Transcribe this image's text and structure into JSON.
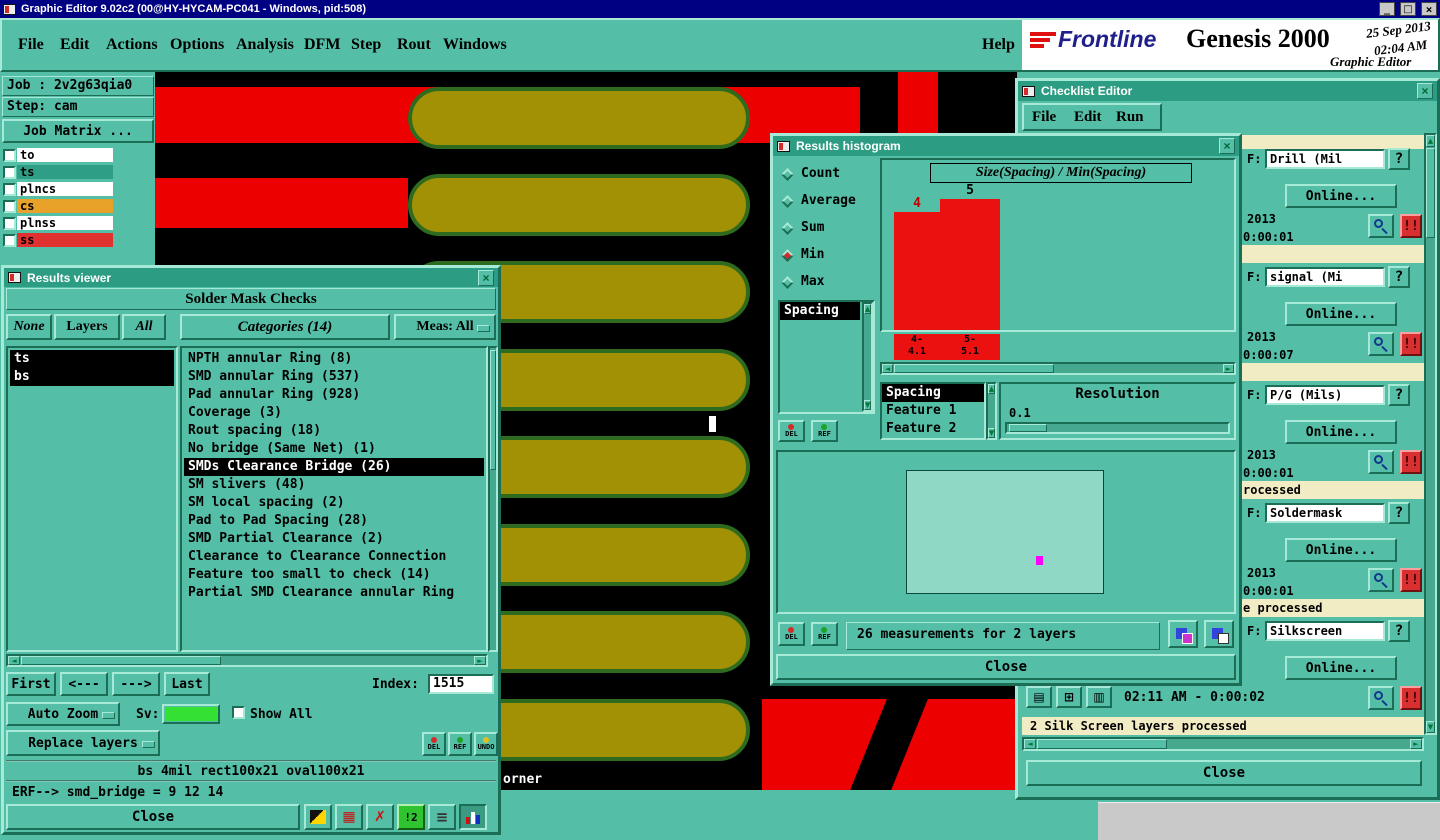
{
  "titlebar": {
    "title": "Graphic Editor 9.02c2 (00@HY-HYCAM-PC041 - Windows, pid:508)",
    "minimize": "_",
    "maximize": "□",
    "close": "×"
  },
  "icons": {
    "up": "▲",
    "down": "▼",
    "left": "◄",
    "right": "►",
    "close": "×"
  },
  "menubar": {
    "file": "File",
    "edit": "Edit",
    "actions": "Actions",
    "options": "Options",
    "analysis": "Analysis",
    "dfm": "DFM",
    "step": "Step",
    "rout": "Rout",
    "windows": "Windows",
    "help": "Help"
  },
  "brand": {
    "name": "Frontline",
    "product": "Genesis 2000",
    "date": "25 Sep 2013",
    "time": "02:04 AM",
    "app": "Graphic Editor"
  },
  "job": {
    "job": "Job : 2v2g63qia0",
    "step": "Step: cam",
    "matrix": "Job Matrix ...",
    "layers": [
      {
        "name": "to"
      },
      {
        "name": "ts"
      },
      {
        "name": "plncs"
      },
      {
        "name": "cs"
      },
      {
        "name": "plnss"
      },
      {
        "name": "ss"
      }
    ]
  },
  "canvas": {
    "corner_text": "orner"
  },
  "viewer": {
    "title": "Results viewer",
    "header": "Solder Mask Checks",
    "none": "None",
    "layers": "Layers",
    "all": "All",
    "categories_header": "Categories (14)",
    "meas": "Meas: All",
    "layer_items": [
      "ts",
      "bs"
    ],
    "categories": [
      "NPTH annular Ring (8)",
      "SMD annular Ring (537)",
      "Pad annular Ring (928)",
      "Coverage (3)",
      "Rout spacing (18)",
      "No bridge (Same Net) (1)",
      "SMDs Clearance Bridge (26)",
      "SM slivers (48)",
      "SM local spacing (2)",
      "Pad to Pad Spacing (28)",
      "SMD Partial Clearance (2)",
      "Clearance to Clearance Connection",
      "Feature too small to check (14)",
      "Partial SMD Clearance annular Ring"
    ],
    "first": "First",
    "prev": "<---",
    "next": "--->",
    "last": "Last",
    "index_label": "Index:",
    "index_value": "1515",
    "auto_zoom": "Auto Zoom",
    "sv_label": "Sv:",
    "show_all": "Show All",
    "replace_layers": "Replace layers",
    "del": "DEL",
    "ref": "REF",
    "undo": "UNDO",
    "status_line": "bs 4mil  rect100x21  oval100x21",
    "erf_line": "ERF--> smd_bridge = 9 12 14",
    "close": "Close",
    "tool_glyphs": {
      "grid": "▦",
      "x": "✗",
      "step2": "!2",
      "report": "≡"
    }
  },
  "histogram": {
    "title": "Results histogram",
    "stat_count": "Count",
    "stat_average": "Average",
    "stat_sum": "Sum",
    "stat_min": "Min",
    "stat_max": "Max",
    "spacing_item": "Spacing",
    "chart_title": "Size(Spacing) / Min(Spacing)",
    "bar1_label": "4",
    "bar2_label": "5",
    "bar1_range1": "4-",
    "bar1_range2": "4.1",
    "bar2_range1": "5-",
    "bar2_range2": "5.1",
    "features": [
      "Spacing",
      "Feature 1",
      "Feature 2"
    ],
    "resolution_label": "Resolution",
    "resolution_value": "0.1",
    "del": "DEL",
    "ref": "REF",
    "measurements": "26 measurements for 2 layers",
    "close": "Close",
    "chart_data": {
      "type": "bar",
      "title": "Size(Spacing) / Min(Spacing)",
      "categories": [
        "4-4.1",
        "5-5.1"
      ],
      "values": [
        4,
        5
      ],
      "selected_stat": "Min",
      "bar_color": "#EC1111"
    }
  },
  "checklist": {
    "title": "Checklist Editor",
    "menu_file": "File",
    "menu_edit": "Edit",
    "menu_run": "Run",
    "f_label": "F:",
    "q": "?",
    "warn": "!!",
    "page_glyphs": [
      "▤",
      "⊞",
      "▥"
    ],
    "rows": [
      {
        "field": "Drill (Mil",
        "online": "Online...",
        "date": "2013",
        "time": "0:00:01",
        "status": ""
      },
      {
        "field": "signal (Mi",
        "online": "Online...",
        "date": "2013",
        "time": "0:00:07",
        "status": ""
      },
      {
        "field": "P/G (Mils)",
        "online": "Online...",
        "date": "2013",
        "time": "0:00:01",
        "status": "rocessed"
      },
      {
        "field": "Soldermask",
        "online": "Online...",
        "date": "2013",
        "time": "0:00:01",
        "status": "e processed"
      },
      {
        "field": "Silkscreen",
        "online": "Online...",
        "time": "02:11 AM - 0:00:02",
        "status": "2 Silk Screen layers processed"
      }
    ],
    "close": "Close"
  }
}
